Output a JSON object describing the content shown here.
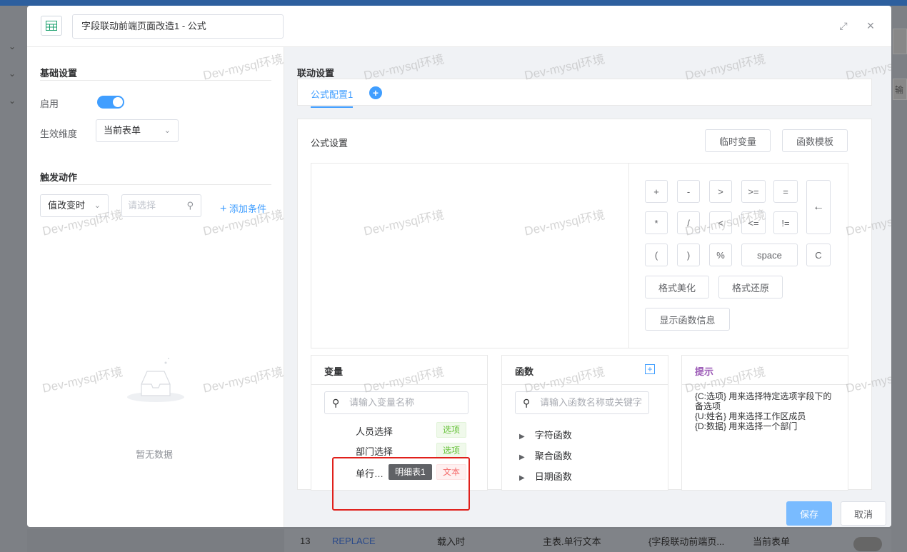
{
  "modal": {
    "title_value": "字段联动前端页面改造1 - 公式",
    "expand_icon": "expand-icon",
    "close_icon": "close-icon"
  },
  "basic": {
    "section_title": "基础设置",
    "enable_label": "启用",
    "enabled": true,
    "scope_label": "生效维度",
    "scope_value": "当前表单"
  },
  "trigger": {
    "section_title": "触发动作",
    "action_value": "值改变时",
    "search_placeholder": "请选择",
    "add_condition": "添加条件",
    "empty_text": "暂无数据"
  },
  "linkage": {
    "section_title": "联动设置",
    "tab_label": "公式配置1",
    "formula_title": "公式设置",
    "temp_var_button": "临时变量",
    "func_template_button": "函数模板"
  },
  "keypad": {
    "row1": [
      "+",
      "-",
      ">",
      ">=",
      "="
    ],
    "row2": [
      "*",
      "/",
      "<",
      "<=",
      "!="
    ],
    "row3": [
      "(",
      ")",
      "%",
      "space",
      "C"
    ],
    "backspace": "←",
    "beautify": "格式美化",
    "restore": "格式还原",
    "show_func_info": "显示函数信息"
  },
  "variables": {
    "title": "变量",
    "search_placeholder": "请输入变量名称",
    "items": [
      {
        "label": "人员选择",
        "tag": "选项"
      },
      {
        "label": "部门选择",
        "tag": "选项"
      },
      {
        "label": "单行…",
        "tag_table": "明细表1",
        "tag": "文本"
      }
    ]
  },
  "functions": {
    "title": "函数",
    "search_placeholder": "请输入函数名称或关键字",
    "items": [
      "字符函数",
      "聚合函数",
      "日期函数"
    ]
  },
  "hints": {
    "title": "提示",
    "lines": [
      "{C:选项} 用来选择特定选项字段下的备选项",
      "{U:姓名} 用来选择工作区成员",
      "{D:数据} 用来选择一个部门"
    ]
  },
  "footer": {
    "save": "保存",
    "cancel": "取消"
  },
  "background_row": {
    "index": "13",
    "func": "REPLACE",
    "trigger": "载入时",
    "field": "主表.单行文本",
    "formula": "{字段联动前端页...",
    "scope": "当前表单"
  },
  "watermark": "Dev-mysql环境",
  "colors": {
    "primary": "#409eff",
    "highlight_box": "#e0201b"
  }
}
